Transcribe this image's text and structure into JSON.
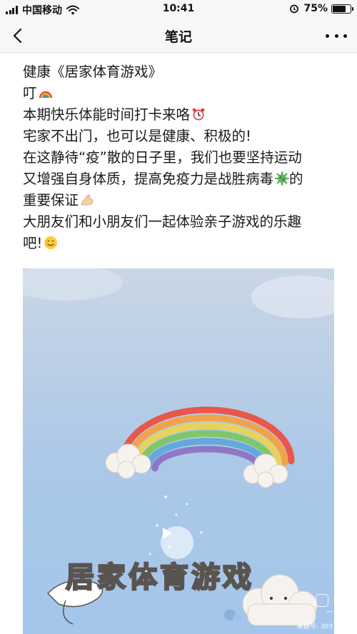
{
  "status_bar": {
    "carrier": "中国移动",
    "time": "10:41",
    "battery_percent": "75%",
    "battery_level": 0.75
  },
  "nav": {
    "title": "笔记",
    "back_icon": "chevron-left-icon",
    "more_icon": "more-dots-icon"
  },
  "article": {
    "lines": [
      "健康《居家体育游戏》",
      "叮",
      "本期快乐体能时间打卡来咯",
      "宅家不出门，也可以是健康、积极的!",
      "在这静待“疫”散的日子里，我们也要坚持运动",
      "又增强自身体质，提高免疫力是战胜病毒",
      "的",
      "重要保证",
      "大朋友们和小朋友们一起体验亲子游戏的乐趣",
      "吧!"
    ],
    "emojis": [
      "rainbow",
      "alarm-clock",
      "virus",
      "flexed-biceps",
      "smiling-face"
    ]
  },
  "video": {
    "title": "居家体育游戏",
    "watermark": "一",
    "watermark_id": "美篇号: 303",
    "play_icon": "play-icon"
  },
  "colors": {
    "bar_bg": "#f7f7f7",
    "text": "#1a1a1a",
    "video_bg": "#aac8e8"
  }
}
